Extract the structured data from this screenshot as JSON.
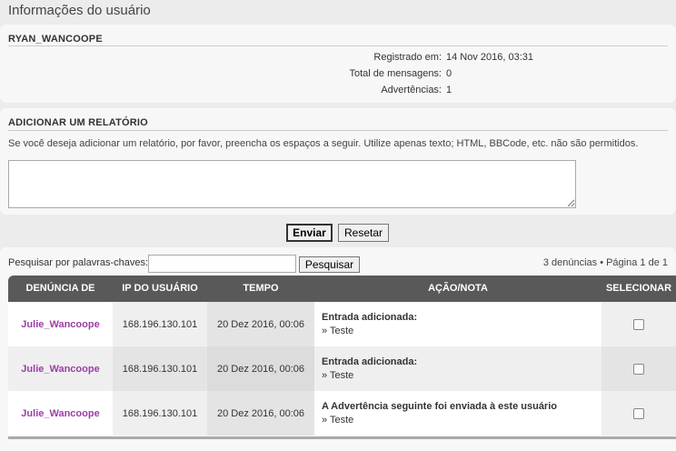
{
  "page": {
    "title": "Informações do usuário"
  },
  "user": {
    "name": "RYAN_WANCOOPE",
    "stats": [
      {
        "label": "Registrado em:",
        "value": "14 Nov 2016, 03:31"
      },
      {
        "label": "Total de mensagens:",
        "value": "0"
      },
      {
        "label": "Advertências:",
        "value": "1"
      }
    ]
  },
  "report": {
    "heading": "ADICIONAR UM RELATÓRIO",
    "description": "Se você deseja adicionar um relatório, por favor, preencha os espaços a seguir. Utilize apenas texto; HTML, BBCode, etc. não são permitidos.",
    "value": "",
    "submit_label": "Enviar",
    "reset_label": "Resetar"
  },
  "search": {
    "label": "Pesquisar por palavras-chaves:",
    "value": "",
    "button_label": "Pesquisar",
    "pager": "3 denúncias • Página 1 de 1"
  },
  "table": {
    "columns": [
      "DENÚNCIA DE",
      "IP DO USUÁRIO",
      "TEMPO",
      "AÇÃO/NOTA",
      "SELECIONAR"
    ],
    "rows": [
      {
        "user": "Julie_Wancoope",
        "ip": "168.196.130.101",
        "time": "20 Dez 2016, 00:06",
        "note_title": "Entrada adicionada:",
        "note_sub": "» Teste",
        "selected": false
      },
      {
        "user": "Julie_Wancoope",
        "ip": "168.196.130.101",
        "time": "20 Dez 2016, 00:06",
        "note_title": "Entrada adicionada:",
        "note_sub": "» Teste",
        "selected": false
      },
      {
        "user": "Julie_Wancoope",
        "ip": "168.196.130.101",
        "time": "20 Dez 2016, 00:06",
        "note_title": "A Advertência seguinte foi enviada à este usuário",
        "note_sub": "» Teste",
        "selected": false
      }
    ]
  },
  "colors": {
    "accent_user": "#9c3fa6",
    "table_header": "#595959"
  }
}
